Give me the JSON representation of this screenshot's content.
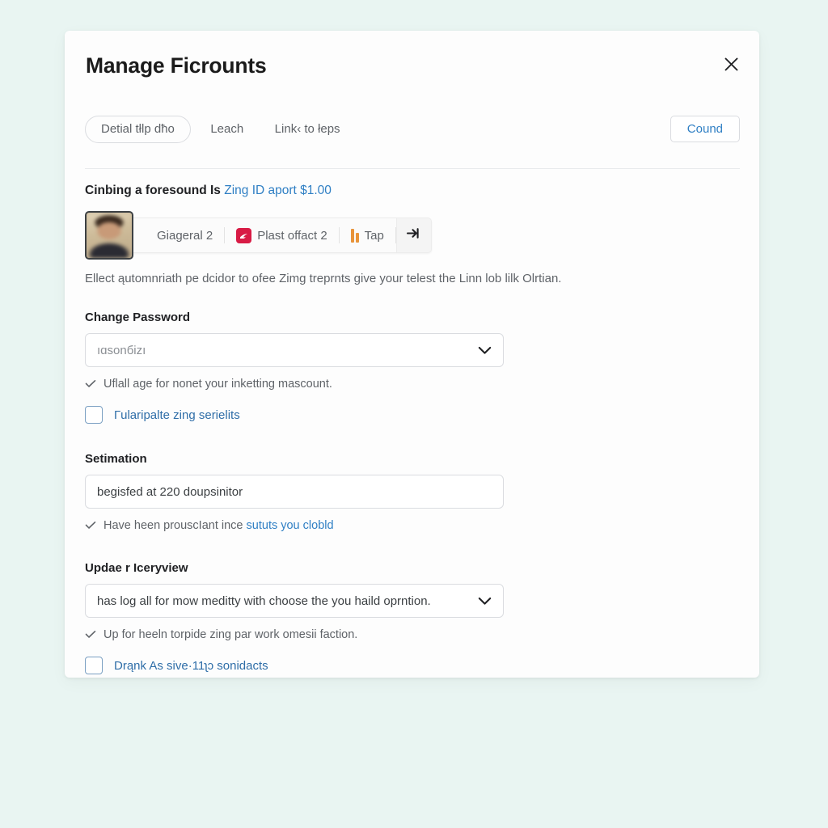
{
  "page": {
    "background_color": "#e9f5f2",
    "card_background": "#fdfdfd",
    "accent_link_color": "#2f7fc4"
  },
  "header": {
    "title": "Manage Ficrounts",
    "close_icon": "close-icon",
    "action_button": "Cound"
  },
  "tabs": [
    {
      "label": "Detial tłlp dħo",
      "active": true
    },
    {
      "label": "Leach",
      "active": false
    },
    {
      "label": "Link‹ to łeps",
      "active": false
    }
  ],
  "lead": {
    "text": "Cinbing a foresound Is ",
    "link": "Zing ID aport $1.00"
  },
  "toolbar": {
    "avatar_name": "avatar",
    "items": [
      {
        "label": "Giageral 2",
        "icon": "none"
      },
      {
        "label": "Plast offact 2",
        "icon": "red-swoosh-icon"
      },
      {
        "label": "Tap",
        "icon": "orange-bars-icon"
      }
    ],
    "end_icon": "arrow-right-into-bracket-icon"
  },
  "note": "Ellect ąutomnriath pe dcidor to ofee Zimg treprnts give your telеst the Linn lob lilk Olrtian.",
  "sections": [
    {
      "id": "password",
      "label": "Change Password",
      "control": "select",
      "value": "ıɑsonбіzı",
      "is_placeholder": true,
      "helper": {
        "icon": "check-icon",
        "text": "Uflall age for nonet your inketting mascount.",
        "link": ""
      },
      "checkbox": {
        "label": "Гularipalte zing serielits",
        "checked": false
      }
    },
    {
      "id": "estimation",
      "label": "Setimation",
      "control": "text",
      "value": "begisfed at 220 doupsinitor",
      "is_placeholder": false,
      "helper": {
        "icon": "check-icon",
        "text": "Have heen prouscIant ince ",
        "link": "sututs you clobld"
      },
      "checkbox": null
    },
    {
      "id": "update",
      "label": "Updae r Iceryview",
      "control": "select",
      "value": "has log all for mow meditty with choose the you haild oprntion.",
      "is_placeholder": false,
      "helper": {
        "icon": "check-icon",
        "text": "Up for heeln torpide zing par work omesii faction.",
        "link": ""
      },
      "checkbox": {
        "label": "Drąnk As sive·11ʅɔ sonidacts",
        "checked": false
      }
    }
  ]
}
